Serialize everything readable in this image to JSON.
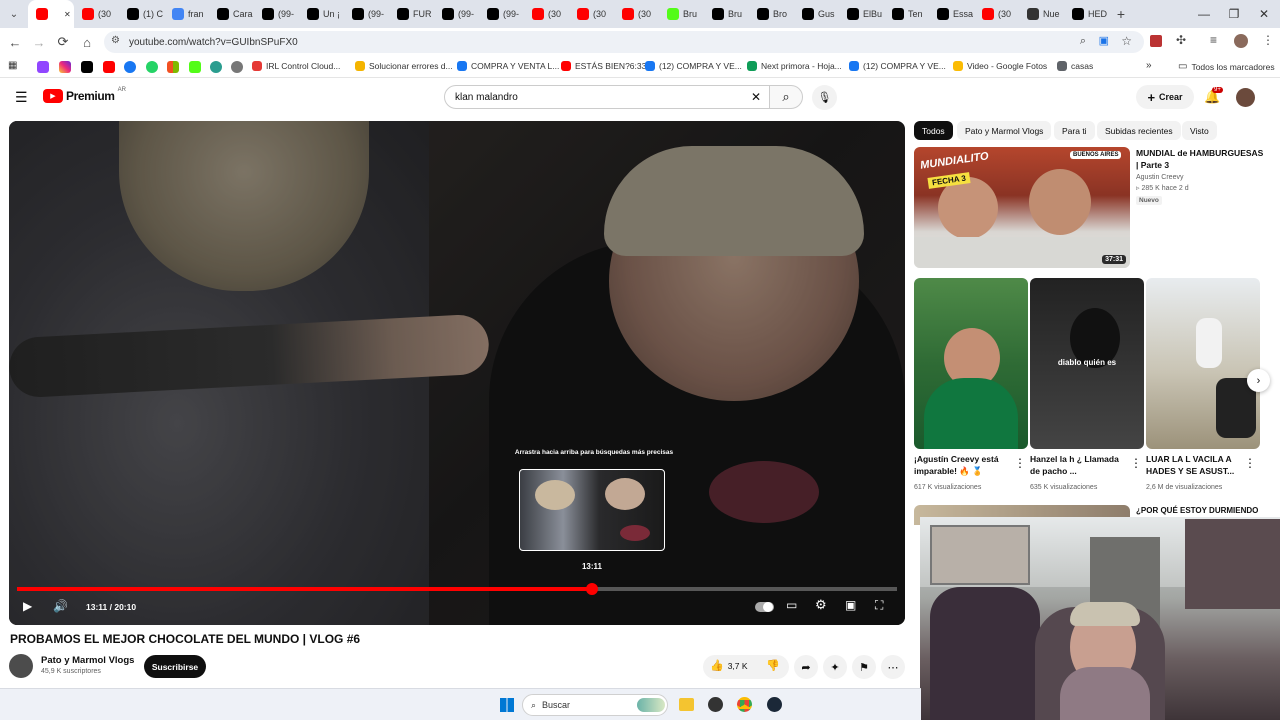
{
  "browser": {
    "tabs": [
      {
        "label": "",
        "color": "#ff0000",
        "active": true
      },
      {
        "label": "(30",
        "color": "#ff0000"
      },
      {
        "label": "(1) C",
        "color": "#000000"
      },
      {
        "label": "fran",
        "color": "#4285f4"
      },
      {
        "label": "Cara",
        "color": "#000000"
      },
      {
        "label": "(99-",
        "color": "#000000"
      },
      {
        "label": "Un ¡",
        "color": "#000000"
      },
      {
        "label": "(99-",
        "color": "#000000"
      },
      {
        "label": "FUR",
        "color": "#000000"
      },
      {
        "label": "(99-",
        "color": "#000000"
      },
      {
        "label": "(99-",
        "color": "#000000"
      },
      {
        "label": "(30",
        "color": "#ff0000"
      },
      {
        "label": "(30",
        "color": "#ff0000"
      },
      {
        "label": "(30",
        "color": "#ff0000"
      },
      {
        "label": "Bru",
        "color": "#53fc18"
      },
      {
        "label": "Bru",
        "color": "#000000"
      },
      {
        "label": "Bro",
        "color": "#000000"
      },
      {
        "label": "Gus",
        "color": "#000000"
      },
      {
        "label": "ElBu",
        "color": "#000000"
      },
      {
        "label": "Ten",
        "color": "#000000"
      },
      {
        "label": "Essa",
        "color": "#000000"
      },
      {
        "label": "(30",
        "color": "#ff0000"
      },
      {
        "label": "Nue",
        "color": "#333333"
      },
      {
        "label": "HED",
        "color": "#000000"
      }
    ],
    "url": "youtube.com/watch?v=GUIbnSPuFX0",
    "bookmarks": [
      {
        "label": "IRL Control Cloud...",
        "color": "#e53935"
      },
      {
        "label": "Solucionar errores d...",
        "color": "#f4b400"
      },
      {
        "label": "COMPRA Y VENTA L...",
        "color": "#1877f2"
      },
      {
        "label": "ESTÁS BIEN?6:33",
        "color": "#ff0000"
      },
      {
        "label": "(12) COMPRA Y VE...",
        "color": "#1877f2"
      },
      {
        "label": "Next primora - Hoja...",
        "color": "#0f9d58"
      },
      {
        "label": "(12) COMPRA Y VE...",
        "color": "#1877f2"
      },
      {
        "label": "Video - Google Fotos",
        "color": "#fbbc04"
      },
      {
        "label": "casas",
        "color": "#5f6368"
      }
    ],
    "all_bookmarks": "Todos los marcadores"
  },
  "youtube": {
    "logo": "Premium",
    "logo_region": "AR",
    "search_value": "klan malandro",
    "create_label": "Crear",
    "notif_count": "9+",
    "player": {
      "current_time": "13:11",
      "duration": "20:10",
      "time_display": "13:11 / 20:10",
      "progress": 0.6537,
      "preview_hint": "Arrastra hacia arriba para búsquedas más precisas",
      "preview_time": "13:11"
    },
    "video_title": "PROBAMOS EL MEJOR CHOCOLATE DEL MUNDO | VLOG #6",
    "channel_name": "Pato y Marmol Vlogs",
    "subscribers": "45,9 K suscriptores",
    "subscribe_label": "Suscribirse",
    "likes": "3,7 K",
    "chips": [
      "Todos",
      "Pato y Marmol Vlogs",
      "Para ti",
      "Subidas recientes",
      "Visto"
    ],
    "featured": {
      "title": "MUNDIAL de HAMBURGUESAS | Parte 3",
      "channel": "Agustin Creevy",
      "views_age": "285 K   hace 2 d",
      "badge": "Nuevo",
      "duration": "37:31",
      "thumb_text_1": "MUNDIALITO",
      "thumb_text_2": "FECHA 3",
      "thumb_tag": "BUENOS AIRES"
    },
    "shorts": [
      {
        "title": "¡Agustín Creevy está imparable! 🔥 🏅",
        "views": "617 K visualizaciones"
      },
      {
        "title": "Hanzel la h ¿ Llamada de pacho ...",
        "views": "635 K visualizaciones",
        "overlay": "diablo quién es"
      },
      {
        "title": "LUAR LA L VACILA A HADES Y SE ASUST...",
        "views": "2,6 M de visualizaciones"
      }
    ],
    "next_title": "¿POR QUÉ ESTOY DURMIENDO"
  },
  "taskbar": {
    "search_label": "Buscar"
  },
  "colors": {
    "yt_red": "#ff0000",
    "progress_red": "#f00",
    "chip_active": "#0f0f0f"
  }
}
